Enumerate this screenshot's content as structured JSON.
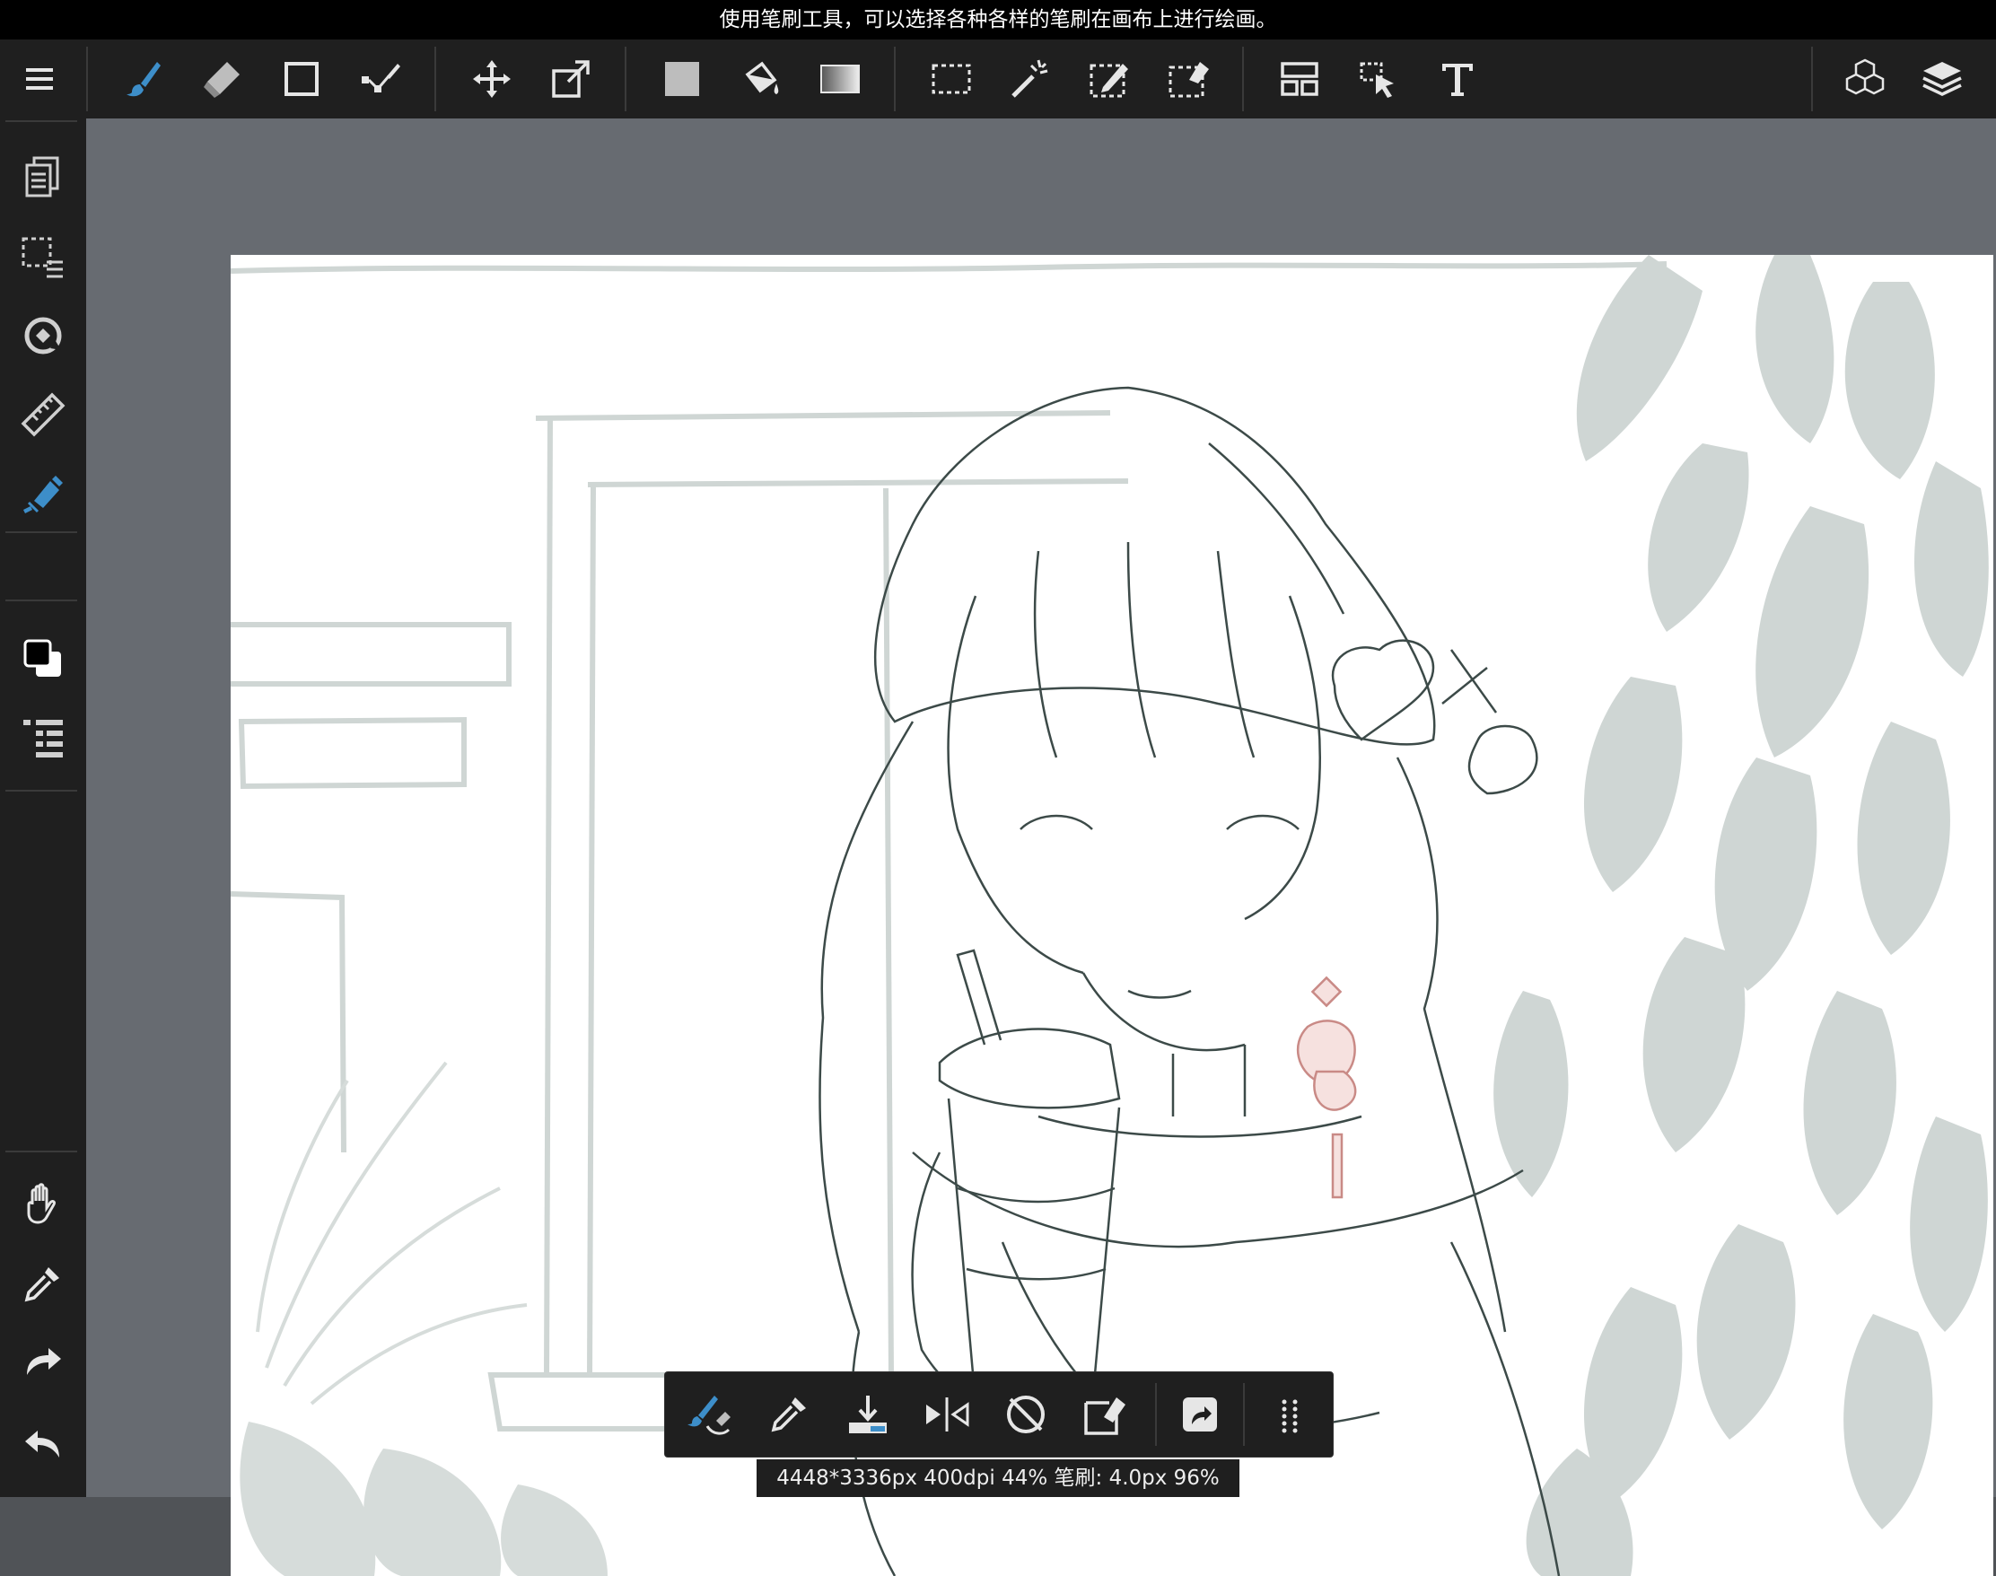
{
  "tip": {
    "text": "使用笔刷工具，可以选择各种各样的笔刷在画布上进行绘画。"
  },
  "toolbar": {
    "tools": [
      {
        "name": "brush-tool",
        "icon": "brush-icon",
        "active": true
      },
      {
        "name": "eraser-tool",
        "icon": "eraser-icon"
      },
      {
        "name": "shape-tool",
        "icon": "square-icon"
      },
      {
        "name": "path-tool",
        "icon": "pen-path-icon"
      },
      {
        "name": "move-tool",
        "icon": "move-icon"
      },
      {
        "name": "transform-tool",
        "icon": "transform-icon"
      },
      {
        "name": "fill-color",
        "icon": "fill-square-icon"
      },
      {
        "name": "bucket-tool",
        "icon": "bucket-icon"
      },
      {
        "name": "gradient-tool",
        "icon": "gradient-icon"
      },
      {
        "name": "select-tool",
        "icon": "marquee-icon"
      },
      {
        "name": "magic-wand-tool",
        "icon": "magic-wand-icon"
      },
      {
        "name": "select-pen-tool",
        "icon": "select-pen-icon"
      },
      {
        "name": "select-eraser-tool",
        "icon": "select-eraser-icon"
      },
      {
        "name": "panel-tool",
        "icon": "comic-panel-icon"
      },
      {
        "name": "operation-tool",
        "icon": "cursor-icon"
      },
      {
        "name": "text-tool",
        "icon": "text-icon"
      }
    ],
    "right": [
      {
        "name": "materials",
        "icon": "cubes-icon"
      },
      {
        "name": "layers",
        "icon": "layers-icon"
      }
    ]
  },
  "sidebar": {
    "items": [
      "pages-icon",
      "selection-icon",
      "rotate-icon",
      "ruler-icon",
      "snap-icon",
      "color-icon",
      "brush-settings-icon",
      "hand-icon",
      "eyedropper-icon",
      "redo-icon",
      "undo-icon"
    ]
  },
  "quickbar": {
    "items": [
      "brush-swap-icon",
      "eyedropper-icon",
      "fill-down-icon",
      "flip-icon",
      "rotate-reset-icon",
      "clear-icon",
      "share-icon",
      "more-icon"
    ]
  },
  "status": {
    "text": "4448*3336px 400dpi 44% 笔刷: 4.0px 96%"
  },
  "colors": {
    "accent": "#3d8ec9",
    "foreground": "#000000",
    "background": "#ffffff",
    "plant": "#cfd6d4",
    "sketch": "#c4cccb"
  }
}
